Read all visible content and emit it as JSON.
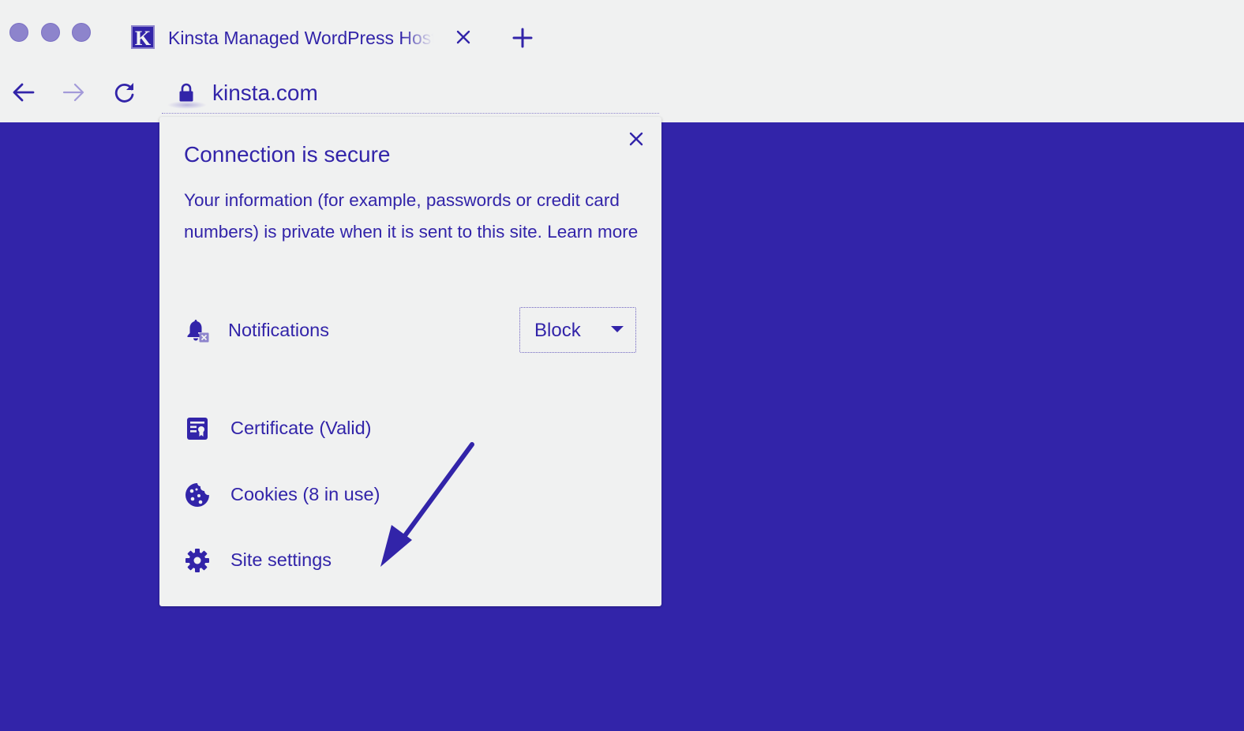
{
  "browser": {
    "tab": {
      "favicon_letter": "K",
      "title": "Kinsta Managed WordPress Hosting"
    },
    "address_bar": {
      "url": "kinsta.com"
    }
  },
  "site_info_popup": {
    "title": "Connection is secure",
    "description": "Your information (for example, passwords or credit card numbers) is private when it is sent to this site.",
    "learn_more": "Learn more",
    "notifications": {
      "label": "Notifications",
      "value": "Block"
    },
    "certificate_label": "Certificate (Valid)",
    "cookies_label": "Cookies (8 in use)",
    "site_settings_label": "Site settings"
  },
  "colors": {
    "accent": "#3224a9",
    "chrome_background": "#f0f1f1",
    "page_background": "#3224a9"
  },
  "icons": {
    "window_controls": [
      "close-dot",
      "minimize-dot",
      "maximize-dot"
    ],
    "toolbar": [
      "back-icon",
      "forward-icon",
      "reload-icon",
      "lock-icon"
    ],
    "popup": [
      "close-icon",
      "notification-bell-icon",
      "certificate-icon",
      "cookie-icon",
      "gear-icon"
    ]
  }
}
